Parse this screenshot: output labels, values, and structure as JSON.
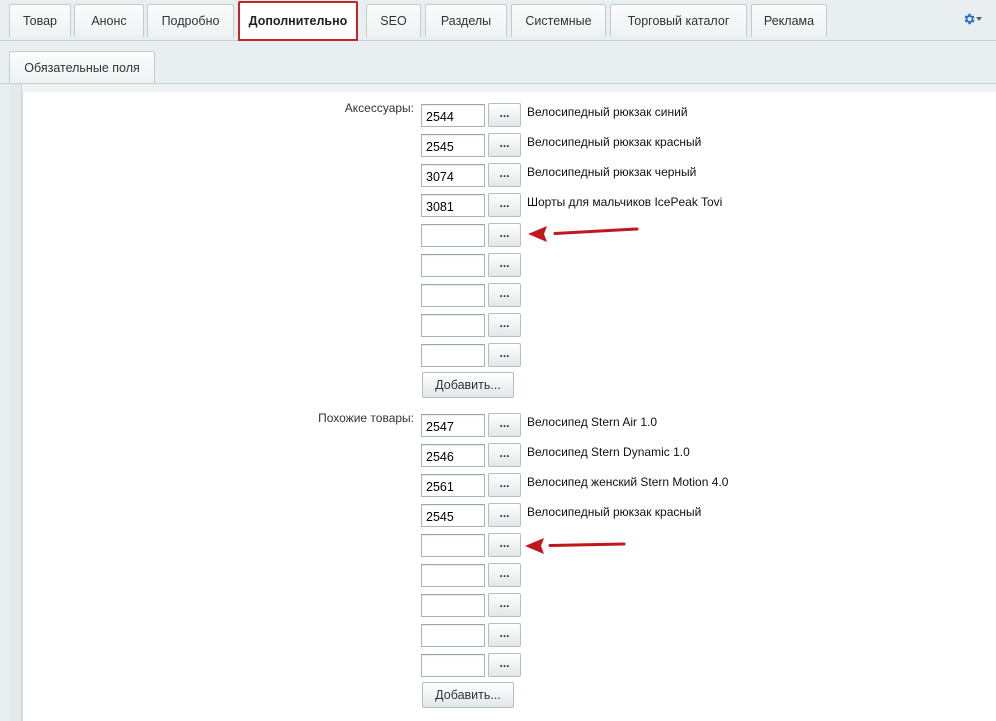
{
  "tabs": [
    {
      "label": "Товар",
      "active": false
    },
    {
      "label": "Анонс",
      "active": false
    },
    {
      "label": "Подробно",
      "active": false
    },
    {
      "label": "Дополнительно",
      "active": true
    },
    {
      "label": "SEO",
      "active": false
    },
    {
      "label": "Разделы",
      "active": false
    },
    {
      "label": "Системные",
      "active": false
    },
    {
      "label": "Торговый каталог",
      "active": false
    },
    {
      "label": "Реклама",
      "active": false
    }
  ],
  "settings_icon": "gear-icon",
  "subtab": {
    "label": "Обязательные поля"
  },
  "accessories": {
    "label": "Аксессуары:",
    "rows": [
      {
        "value": "2544",
        "name": "Велосипедный рюкзак синий"
      },
      {
        "value": "2545",
        "name": "Велосипедный рюкзак красный"
      },
      {
        "value": "3074",
        "name": "Велосипедный рюкзак черный"
      },
      {
        "value": "3081",
        "name": "Шорты для мальчиков IcePeak Tovi"
      },
      {
        "value": "",
        "name": ""
      },
      {
        "value": "",
        "name": ""
      },
      {
        "value": "",
        "name": ""
      },
      {
        "value": "",
        "name": ""
      },
      {
        "value": "",
        "name": ""
      }
    ],
    "add_label": "Добавить..."
  },
  "similar": {
    "label": "Похожие товары:",
    "rows": [
      {
        "value": "2547",
        "name": "Велосипед Stern Air 1.0"
      },
      {
        "value": "2546",
        "name": "Велосипед Stern Dynamic 1.0"
      },
      {
        "value": "2561",
        "name": "Велосипед женский Stern Motion 4.0"
      },
      {
        "value": "2545",
        "name": "Велосипедный рюкзак красный"
      },
      {
        "value": "",
        "name": ""
      },
      {
        "value": "",
        "name": ""
      },
      {
        "value": "",
        "name": ""
      },
      {
        "value": "",
        "name": ""
      },
      {
        "value": "",
        "name": ""
      }
    ],
    "add_label": "Добавить..."
  },
  "picker_label": "...",
  "colors": {
    "active_tab_border": "#c2262b",
    "annotation_arrow": "#c0181e",
    "gear": "#2a72c8"
  }
}
